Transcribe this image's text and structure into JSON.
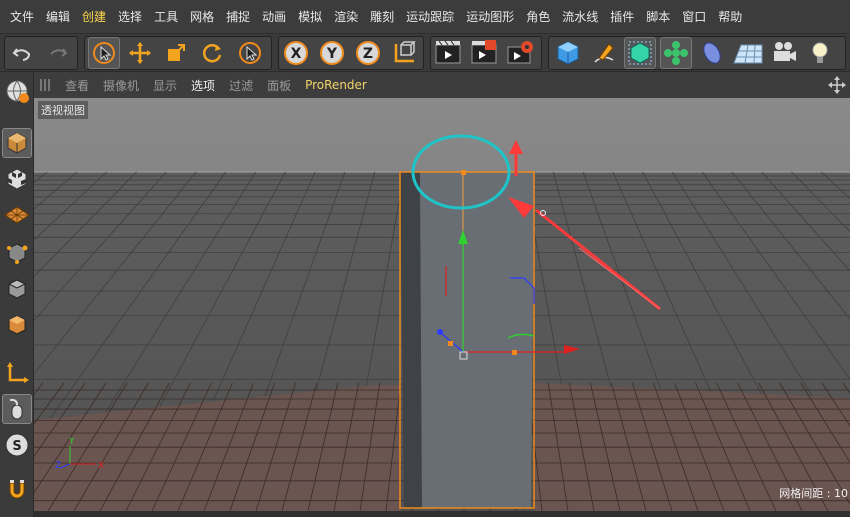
{
  "menu": [
    "文件",
    "编辑",
    "创建",
    "选择",
    "工具",
    "网格",
    "捕捉",
    "动画",
    "模拟",
    "渲染",
    "雕刻",
    "运动跟踪",
    "运动图形",
    "角色",
    "流水线",
    "插件",
    "脚本",
    "窗口",
    "帮助"
  ],
  "viewport_menu": [
    "查看",
    "摄像机",
    "显示",
    "选项",
    "过滤",
    "面板",
    "ProRender"
  ],
  "viewport_title": "透视视图",
  "grid_spacing_label": "网格间距 : 10",
  "axis_labels": {
    "x": "X",
    "y": "Y",
    "z": "Z"
  },
  "colors": {
    "menu_bg": "#3c3c3c",
    "highlight_menu": "#ffd84d",
    "selection_orange": "#f08a1c",
    "annotation_circle": "#1fc4c8",
    "annotation_arrow": "#ff3a3a",
    "axis_x": "#e02020",
    "axis_y": "#2fd02f",
    "axis_z": "#2b3bff"
  },
  "toolbar_icons": [
    "undo-icon",
    "redo-icon",
    "live-select-icon",
    "move-icon",
    "scale-icon",
    "rotate-icon",
    "last-tool-icon",
    "x-axis-lock-icon",
    "y-axis-lock-icon",
    "z-axis-lock-icon",
    "world-coordinates-icon",
    "render-view-icon",
    "render-picture-viewer-icon",
    "render-settings-icon",
    "cube-icon",
    "pen-spline-icon",
    "subdivision-icon",
    "cloner-icon",
    "deformer-icon",
    "floor-icon",
    "camera-icon",
    "light-icon"
  ],
  "palette_icons": [
    "model-mode-icon",
    "texture-mode-icon",
    "workplane-icon",
    "points-mode-icon",
    "edges-mode-icon",
    "polygons-mode-icon",
    "axis-mode-icon",
    "tweak-icon",
    "snap-icon",
    "magnet-icon"
  ]
}
